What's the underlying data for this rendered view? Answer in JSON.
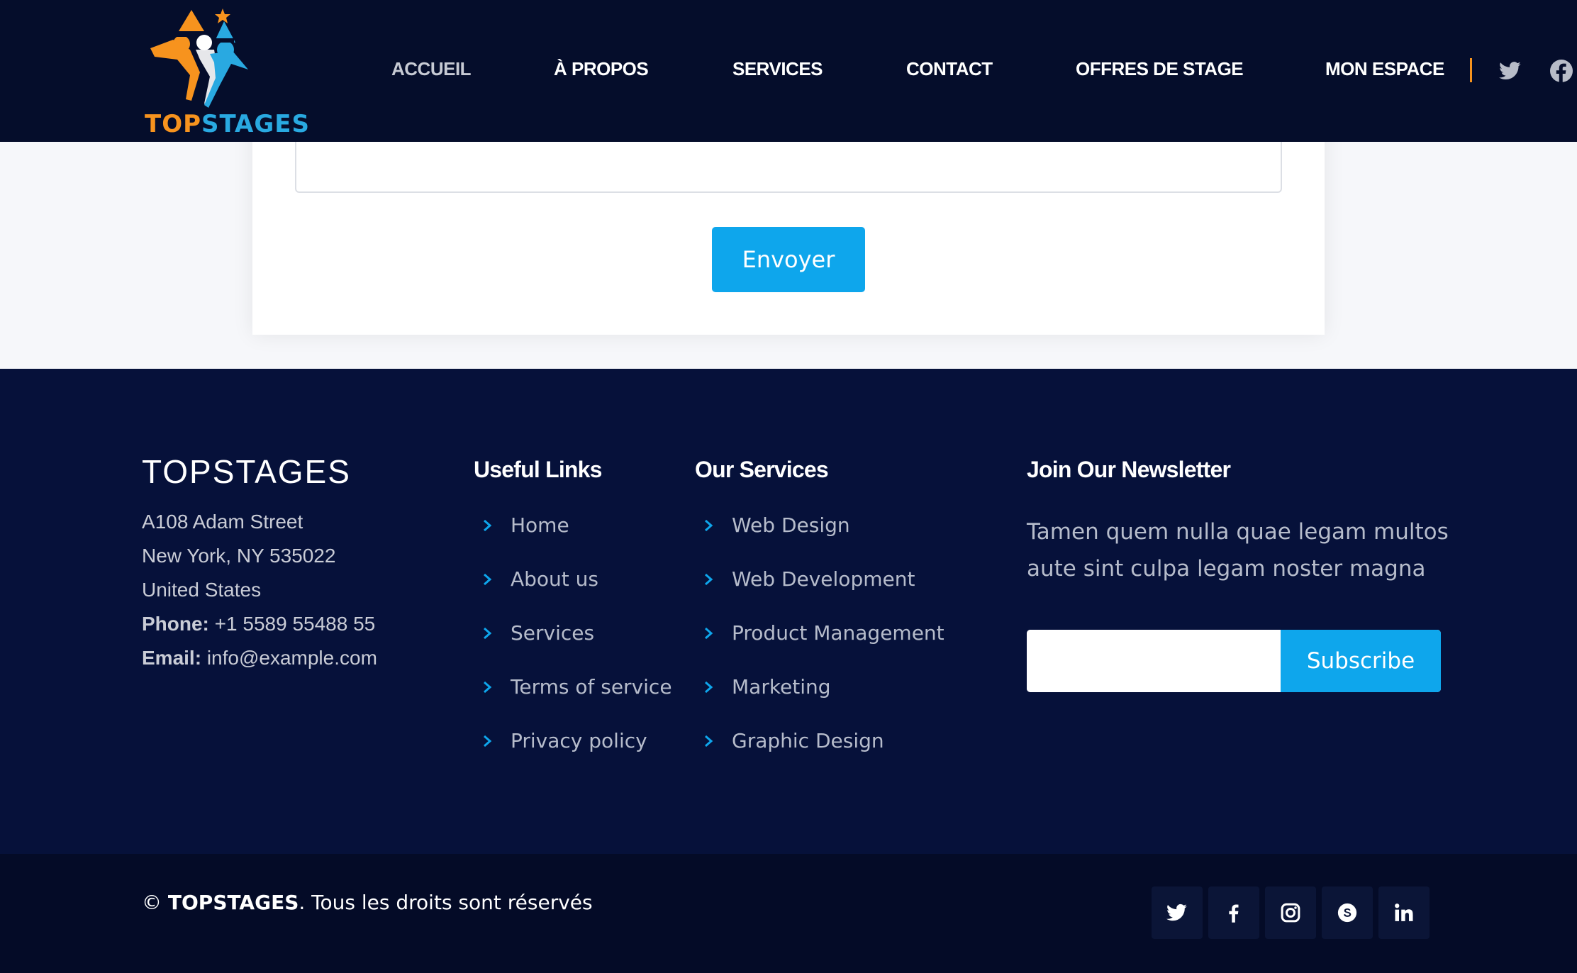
{
  "header": {
    "logo_text_top": "TOP",
    "logo_text_stages": "STAGES",
    "nav": [
      {
        "label": "ACCUEIL",
        "active": true
      },
      {
        "label": "À PROPOS",
        "active": false
      },
      {
        "label": "SERVICES",
        "active": false
      },
      {
        "label": "CONTACT",
        "active": false
      },
      {
        "label": "OFFRES DE STAGE",
        "active": false
      },
      {
        "label": "MON ESPACE",
        "active": false
      }
    ],
    "social_icons": [
      "twitter-icon",
      "facebook-icon"
    ]
  },
  "contact_form": {
    "message_value": "",
    "send_label": "Envoyer"
  },
  "footer": {
    "brand": {
      "title": "TOPSTAGES",
      "address_line1": "A108 Adam Street",
      "address_line2": "New York, NY 535022",
      "address_line3": "United States",
      "phone_label": "Phone:",
      "phone_value": "+1 5589 55488 55",
      "email_label": "Email:",
      "email_value": "info@example.com"
    },
    "useful_links": {
      "title": "Useful Links",
      "items": [
        "Home",
        "About us",
        "Services",
        "Terms of service",
        "Privacy policy"
      ]
    },
    "our_services": {
      "title": "Our Services",
      "items": [
        "Web Design",
        "Web Development",
        "Product Management",
        "Marketing",
        "Graphic Design"
      ]
    },
    "newsletter": {
      "title": "Join Our Newsletter",
      "text": "Tamen quem nulla quae legam multos aute sint culpa legam noster magna",
      "email_value": "",
      "subscribe_label": "Subscribe"
    },
    "bottom": {
      "copyright_symbol": "©",
      "copyright_brand": "TOPSTAGES",
      "copyright_text": ". Tous les droits sont réservés",
      "social_icons": [
        "twitter-icon",
        "facebook-icon",
        "instagram-icon",
        "skype-icon",
        "linkedin-icon"
      ]
    }
  },
  "colors": {
    "header_bg": "#050d2b",
    "footer_bg": "#06113a",
    "footer_bottom_bg": "#040b27",
    "accent_blue": "#0ea6ec",
    "accent_orange": "#f7931e",
    "logo_blue": "#29a9e1"
  }
}
